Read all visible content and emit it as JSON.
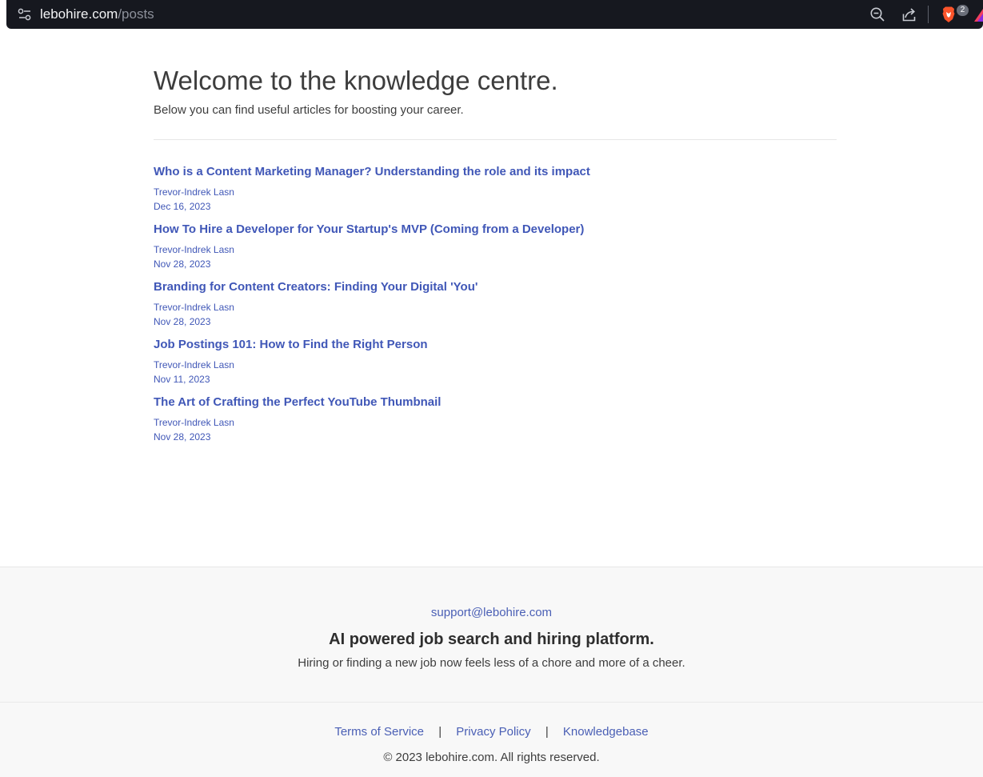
{
  "browser": {
    "url_host": "lebohire.com",
    "url_path": "/posts",
    "shield_badge": "2",
    "icons": [
      "site-settings-icon",
      "zoom-icon",
      "share-icon",
      "brave-shield-icon",
      "brave-rewards-icon"
    ]
  },
  "main": {
    "title": "Welcome to the knowledge centre.",
    "subtitle": "Below you can find useful articles for boosting your career.",
    "posts": [
      {
        "title": "Who is a Content Marketing Manager? Understanding the role and its impact",
        "author": "Trevor-Indrek Lasn",
        "date": "Dec 16, 2023"
      },
      {
        "title": "How To Hire a Developer for Your Startup's MVP (Coming from a Developer)",
        "author": "Trevor-Indrek Lasn",
        "date": "Nov 28, 2023"
      },
      {
        "title": "Branding for Content Creators: Finding Your Digital 'You'",
        "author": "Trevor-Indrek Lasn",
        "date": "Nov 28, 2023"
      },
      {
        "title": "Job Postings 101: How to Find the Right Person",
        "author": "Trevor-Indrek Lasn",
        "date": "Nov 11, 2023"
      },
      {
        "title": "The Art of Crafting the Perfect YouTube Thumbnail",
        "author": "Trevor-Indrek Lasn",
        "date": "Nov 28, 2023"
      }
    ]
  },
  "footer": {
    "email": "support@lebohire.com",
    "tagline": "AI powered job search and hiring platform.",
    "description": "Hiring or finding a new job now feels less of a chore and more of a cheer.",
    "links": [
      "Terms of Service",
      "Privacy Policy",
      "Knowledgebase"
    ],
    "separator": "|",
    "copyright": "© 2023 lebohire.com. All rights reserved."
  },
  "colors": {
    "link": "#4057b7",
    "toolbar_bg": "#16181f",
    "brave_orange": "#fb542b",
    "footer_bg": "#f8f8f8"
  }
}
